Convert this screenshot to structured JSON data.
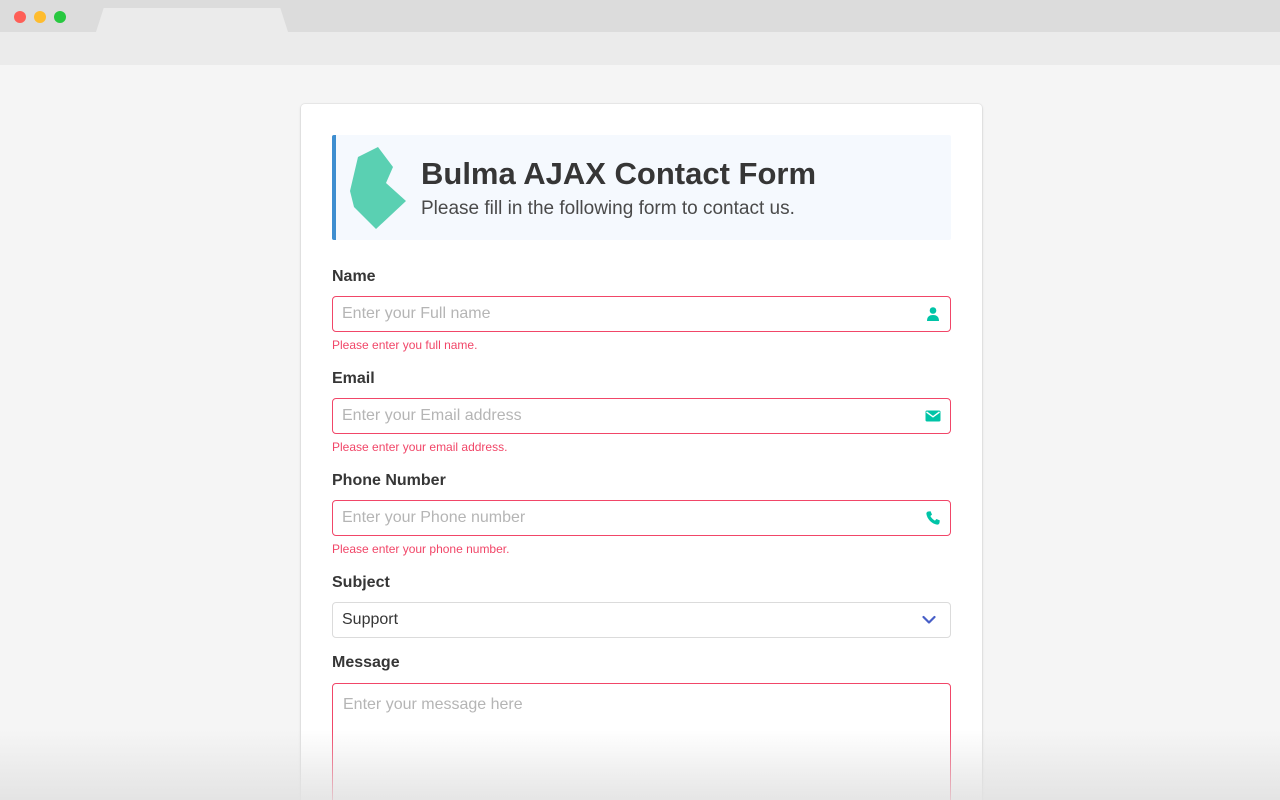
{
  "window": {
    "controls": {
      "close_color": "#fe5f57",
      "minimize_color": "#febc2e",
      "maximize_color": "#28c840"
    }
  },
  "header": {
    "logo_icon": "bulma-logo-icon",
    "logo_color": "#5ad0b2",
    "title": "Bulma AJAX Contact Form",
    "subtitle": "Please fill in the following form to contact us.",
    "accent_color": "#3e8ed0"
  },
  "form": {
    "name": {
      "label": "Name",
      "placeholder": "Enter your Full name",
      "value": "",
      "icon": "user-icon",
      "error": "Please enter you full name."
    },
    "email": {
      "label": "Email",
      "placeholder": "Enter your Email address",
      "value": "",
      "icon": "envelope-icon",
      "error": "Please enter your email address."
    },
    "phone": {
      "label": "Phone Number",
      "placeholder": "Enter your Phone number",
      "value": "",
      "icon": "phone-icon",
      "error": "Please enter your phone number."
    },
    "subject": {
      "label": "Subject",
      "selected": "Support",
      "icon": "chevron-down-icon"
    },
    "message": {
      "label": "Message",
      "placeholder": "Enter your message here",
      "value": ""
    }
  },
  "colors": {
    "danger": "#f14668",
    "icon_teal": "#00c4a7",
    "chevron_blue": "#485fc7"
  }
}
